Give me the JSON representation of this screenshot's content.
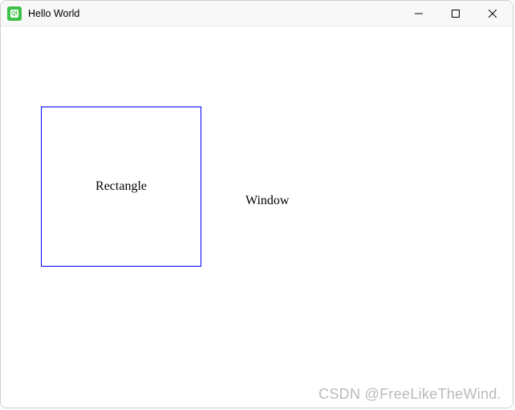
{
  "titlebar": {
    "title": "Hello World"
  },
  "controls": {
    "minimize": "minimize-icon",
    "maximize": "maximize-icon",
    "close": "close-icon"
  },
  "content": {
    "rectangle_label": "Rectangle",
    "window_label": "Window"
  },
  "watermark": "CSDN @FreeLikeTheWind."
}
